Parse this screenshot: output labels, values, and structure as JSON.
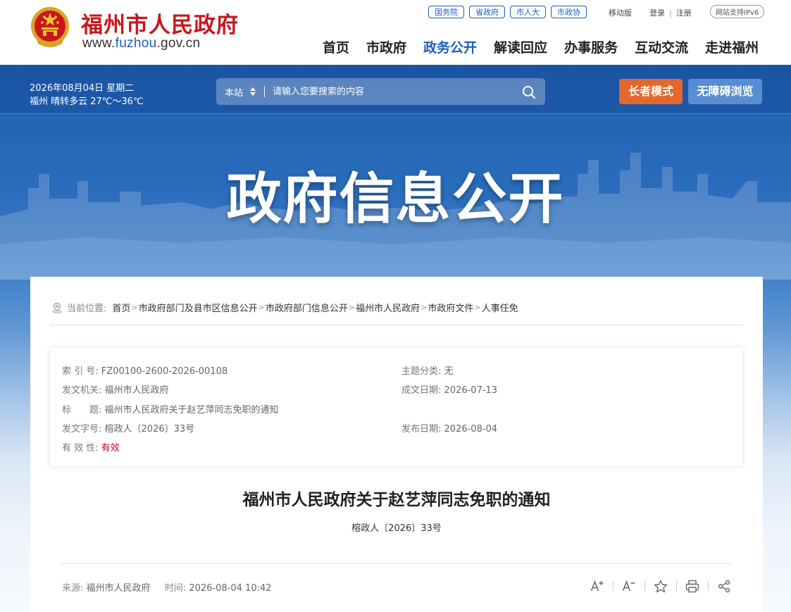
{
  "header": {
    "site_name": "福州市人民政府",
    "url_prefix": "www.",
    "url_highlight": "fuzhou",
    "url_suffix": ".gov.cn",
    "top_links": [
      "国务院",
      "省政府",
      "市人大",
      "市政协"
    ],
    "mobile": "移动版",
    "login": "登录",
    "register": "注册",
    "ipv6": "网站支持IPv6",
    "nav": [
      "首页",
      "市政府",
      "政务公开",
      "解读回应",
      "办事服务",
      "互动交流",
      "走进福州"
    ],
    "nav_active_index": 2
  },
  "toolbar": {
    "date": "2026年08月04日 星期二",
    "weather": "福州 晴转多云 27℃～36℃",
    "search_scope": "本站",
    "search_placeholder": "请输入您要搜索的内容",
    "elder_mode": "长者模式",
    "accessibility": "无障碍浏览"
  },
  "banner": {
    "title": "政府信息公开"
  },
  "breadcrumb": {
    "label": "当前位置:",
    "items": [
      "首页",
      "市政府部门及县市区信息公开",
      "市政府部门信息公开",
      "福州市人民政府",
      "市政府文件",
      "人事任免"
    ],
    "separator": ">"
  },
  "meta": {
    "index_label": "索 引 号:",
    "index_value": "FZ00100-2600-2026-00108",
    "topic_label": "主题分类:",
    "topic_value": "无",
    "issuer_label": "发文机关:",
    "issuer_value": "福州市人民政府",
    "written_label": "成文日期:",
    "written_value": "2026-07-13",
    "title_label": "标　　题:",
    "title_value": "福州市人民政府关于赵艺萍同志免职的通知",
    "doc_no_label": "发文字号:",
    "doc_no_value": "榕政人〔2026〕33号",
    "publish_label": "发布日期:",
    "publish_value": "2026-08-04",
    "validity_label": "有 效 性:",
    "validity_value": "有效"
  },
  "article": {
    "title": "福州市人民政府关于赵艺萍同志免职的通知",
    "number": "榕政人〔2026〕33号",
    "source_label": "来源:",
    "source_value": "福州市人民政府",
    "time_label": "时间:",
    "time_value": "2026-08-04 10:42"
  },
  "colors": {
    "brand_red": "#c8161d",
    "link_blue": "#1a5ebf",
    "elder_orange": "#e4672c",
    "banner_blue": "#2a6cbc"
  },
  "icons": [
    "national-emblem-icon",
    "sort-arrows-icon",
    "search-icon",
    "location-icon",
    "font-increase-icon",
    "font-decrease-icon",
    "star-icon",
    "print-icon",
    "share-icon"
  ]
}
